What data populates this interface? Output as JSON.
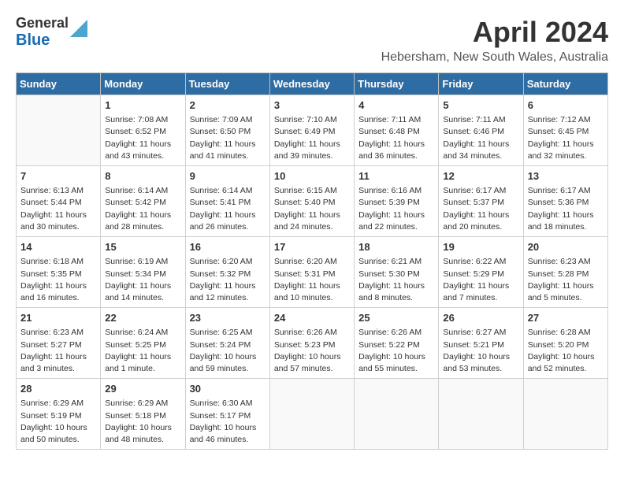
{
  "header": {
    "logo_general": "General",
    "logo_blue": "Blue",
    "month_title": "April 2024",
    "location": "Hebersham, New South Wales, Australia"
  },
  "days_of_week": [
    "Sunday",
    "Monday",
    "Tuesday",
    "Wednesday",
    "Thursday",
    "Friday",
    "Saturday"
  ],
  "weeks": [
    [
      {
        "day": "",
        "info": ""
      },
      {
        "day": "1",
        "info": "Sunrise: 7:08 AM\nSunset: 6:52 PM\nDaylight: 11 hours\nand 43 minutes."
      },
      {
        "day": "2",
        "info": "Sunrise: 7:09 AM\nSunset: 6:50 PM\nDaylight: 11 hours\nand 41 minutes."
      },
      {
        "day": "3",
        "info": "Sunrise: 7:10 AM\nSunset: 6:49 PM\nDaylight: 11 hours\nand 39 minutes."
      },
      {
        "day": "4",
        "info": "Sunrise: 7:11 AM\nSunset: 6:48 PM\nDaylight: 11 hours\nand 36 minutes."
      },
      {
        "day": "5",
        "info": "Sunrise: 7:11 AM\nSunset: 6:46 PM\nDaylight: 11 hours\nand 34 minutes."
      },
      {
        "day": "6",
        "info": "Sunrise: 7:12 AM\nSunset: 6:45 PM\nDaylight: 11 hours\nand 32 minutes."
      }
    ],
    [
      {
        "day": "7",
        "info": "Sunrise: 6:13 AM\nSunset: 5:44 PM\nDaylight: 11 hours\nand 30 minutes."
      },
      {
        "day": "8",
        "info": "Sunrise: 6:14 AM\nSunset: 5:42 PM\nDaylight: 11 hours\nand 28 minutes."
      },
      {
        "day": "9",
        "info": "Sunrise: 6:14 AM\nSunset: 5:41 PM\nDaylight: 11 hours\nand 26 minutes."
      },
      {
        "day": "10",
        "info": "Sunrise: 6:15 AM\nSunset: 5:40 PM\nDaylight: 11 hours\nand 24 minutes."
      },
      {
        "day": "11",
        "info": "Sunrise: 6:16 AM\nSunset: 5:39 PM\nDaylight: 11 hours\nand 22 minutes."
      },
      {
        "day": "12",
        "info": "Sunrise: 6:17 AM\nSunset: 5:37 PM\nDaylight: 11 hours\nand 20 minutes."
      },
      {
        "day": "13",
        "info": "Sunrise: 6:17 AM\nSunset: 5:36 PM\nDaylight: 11 hours\nand 18 minutes."
      }
    ],
    [
      {
        "day": "14",
        "info": "Sunrise: 6:18 AM\nSunset: 5:35 PM\nDaylight: 11 hours\nand 16 minutes."
      },
      {
        "day": "15",
        "info": "Sunrise: 6:19 AM\nSunset: 5:34 PM\nDaylight: 11 hours\nand 14 minutes."
      },
      {
        "day": "16",
        "info": "Sunrise: 6:20 AM\nSunset: 5:32 PM\nDaylight: 11 hours\nand 12 minutes."
      },
      {
        "day": "17",
        "info": "Sunrise: 6:20 AM\nSunset: 5:31 PM\nDaylight: 11 hours\nand 10 minutes."
      },
      {
        "day": "18",
        "info": "Sunrise: 6:21 AM\nSunset: 5:30 PM\nDaylight: 11 hours\nand 8 minutes."
      },
      {
        "day": "19",
        "info": "Sunrise: 6:22 AM\nSunset: 5:29 PM\nDaylight: 11 hours\nand 7 minutes."
      },
      {
        "day": "20",
        "info": "Sunrise: 6:23 AM\nSunset: 5:28 PM\nDaylight: 11 hours\nand 5 minutes."
      }
    ],
    [
      {
        "day": "21",
        "info": "Sunrise: 6:23 AM\nSunset: 5:27 PM\nDaylight: 11 hours\nand 3 minutes."
      },
      {
        "day": "22",
        "info": "Sunrise: 6:24 AM\nSunset: 5:25 PM\nDaylight: 11 hours\nand 1 minute."
      },
      {
        "day": "23",
        "info": "Sunrise: 6:25 AM\nSunset: 5:24 PM\nDaylight: 10 hours\nand 59 minutes."
      },
      {
        "day": "24",
        "info": "Sunrise: 6:26 AM\nSunset: 5:23 PM\nDaylight: 10 hours\nand 57 minutes."
      },
      {
        "day": "25",
        "info": "Sunrise: 6:26 AM\nSunset: 5:22 PM\nDaylight: 10 hours\nand 55 minutes."
      },
      {
        "day": "26",
        "info": "Sunrise: 6:27 AM\nSunset: 5:21 PM\nDaylight: 10 hours\nand 53 minutes."
      },
      {
        "day": "27",
        "info": "Sunrise: 6:28 AM\nSunset: 5:20 PM\nDaylight: 10 hours\nand 52 minutes."
      }
    ],
    [
      {
        "day": "28",
        "info": "Sunrise: 6:29 AM\nSunset: 5:19 PM\nDaylight: 10 hours\nand 50 minutes."
      },
      {
        "day": "29",
        "info": "Sunrise: 6:29 AM\nSunset: 5:18 PM\nDaylight: 10 hours\nand 48 minutes."
      },
      {
        "day": "30",
        "info": "Sunrise: 6:30 AM\nSunset: 5:17 PM\nDaylight: 10 hours\nand 46 minutes."
      },
      {
        "day": "",
        "info": ""
      },
      {
        "day": "",
        "info": ""
      },
      {
        "day": "",
        "info": ""
      },
      {
        "day": "",
        "info": ""
      }
    ]
  ]
}
